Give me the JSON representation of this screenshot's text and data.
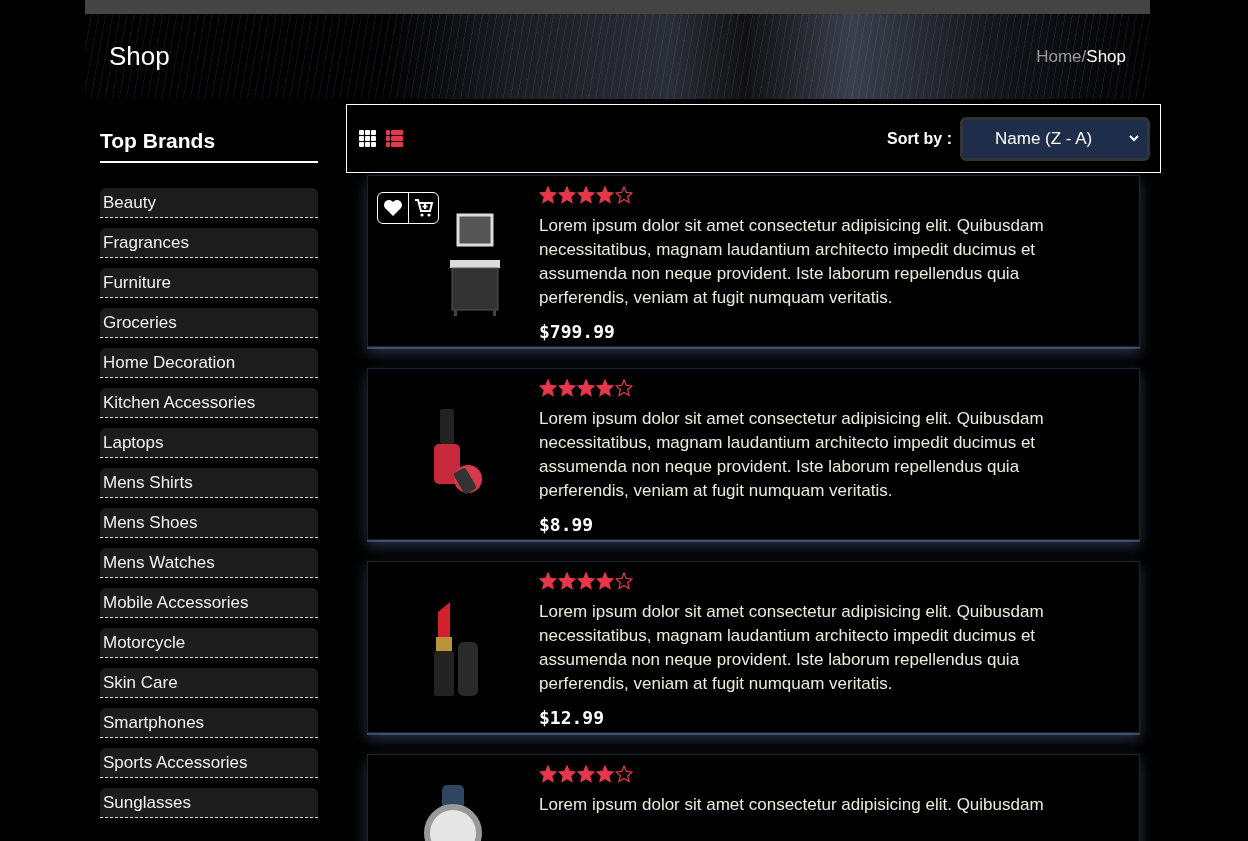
{
  "hero": {
    "title": "Shop",
    "breadcrumb": [
      {
        "label": "Home",
        "current": false
      },
      {
        "label": "/",
        "current": false
      },
      {
        "label": "Shop",
        "current": true
      }
    ]
  },
  "sidebar": {
    "title": "Top Brands",
    "items": [
      "Beauty",
      "Fragrances",
      "Furniture",
      "Groceries",
      "Home Decoration",
      "Kitchen Accessories",
      "Laptops",
      "Mens Shirts",
      "Mens Shoes",
      "Mens Watches",
      "Mobile Accessories",
      "Motorcycle",
      "Skin Care",
      "Smartphones",
      "Sports Accessories",
      "Sunglasses"
    ]
  },
  "toolbar": {
    "views": [
      {
        "kind": "grid",
        "selected": false
      },
      {
        "kind": "list",
        "selected": true
      }
    ],
    "sort_label": "Sort by :",
    "sort_value": "Name (Z - A)"
  },
  "products": [
    {
      "kind": "vanity",
      "stars": 4,
      "actions_shown": true,
      "description": "Lorem ipsum dolor sit amet consectetur adipisicing elit. Quibusdam necessitatibus, magnam laudantium architecto impedit ducimus et assumenda non neque provident. Iste laborum repellendus quia perferendis, veniam at fugit numquam veritatis.",
      "price": "$799.99"
    },
    {
      "kind": "nail-polish",
      "stars": 4,
      "actions_shown": false,
      "description": "Lorem ipsum dolor sit amet consectetur adipisicing elit. Quibusdam necessitatibus, magnam laudantium architecto impedit ducimus et assumenda non neque provident. Iste laborum repellendus quia perferendis, veniam at fugit numquam veritatis.",
      "price": "$8.99"
    },
    {
      "kind": "lipstick",
      "stars": 4,
      "actions_shown": false,
      "description": "Lorem ipsum dolor sit amet consectetur adipisicing elit. Quibusdam necessitatibus, magnam laudantium architecto impedit ducimus et assumenda non neque provident. Iste laborum repellendus quia perferendis, veniam at fugit numquam veritatis.",
      "price": "$12.99"
    },
    {
      "kind": "watch",
      "stars": 4,
      "actions_shown": false,
      "description": "Lorem ipsum dolor sit amet consectetur adipisicing elit. Quibusdam"
    }
  ]
}
